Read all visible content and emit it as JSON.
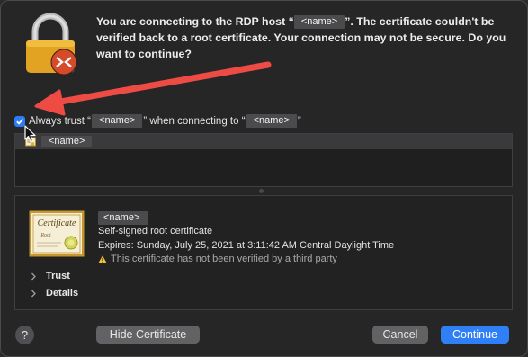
{
  "dialog": {
    "message_before_host": "You are connecting to the RDP host “",
    "host_name": "<name>",
    "message_after_host": "”. The certificate couldn't be verified back to a root certificate. Your connection may not be secure. Do you want to continue?"
  },
  "trust_option": {
    "checked": true,
    "text_1": "Always trust “",
    "cert_name": "<name>",
    "text_2": "” when connecting to “",
    "host_name": "<name>",
    "text_3": "”"
  },
  "certificate_tree": {
    "items": [
      {
        "label": "<name>"
      }
    ]
  },
  "certificate_detail": {
    "name": "<name>",
    "type": "Self-signed root certificate",
    "expires": "Expires: Sunday, July 25, 2021 at 3:11:42 AM Central Daylight Time",
    "warning": "This certificate has not been verified by a third party",
    "sections": [
      "Trust",
      "Details"
    ]
  },
  "icons": {
    "lock": "padlock-icon",
    "rdp_badge": "remote-desktop-icon",
    "certificate": "certificate-icon",
    "warning": "warning-triangle-icon",
    "chevron": "chevron-right-icon",
    "help": "help-icon"
  },
  "buttons": {
    "help": "?",
    "hide_certificate": "Hide Certificate",
    "cancel": "Cancel",
    "continue": "Continue"
  },
  "colors": {
    "accent": "#2f7ff6",
    "annotation_arrow": "#ef4b45",
    "warning": "#f2c33b"
  }
}
